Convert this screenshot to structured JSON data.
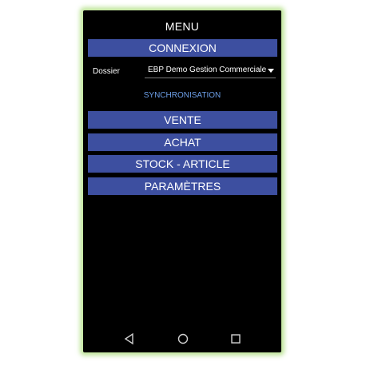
{
  "header": {
    "title": "MENU"
  },
  "menu": {
    "connexion_label": "CONNEXION",
    "vente_label": "VENTE",
    "achat_label": "ACHAT",
    "stock_label": "STOCK - ARTICLE",
    "parametres_label": "PARAMÈTRES"
  },
  "dossier": {
    "label": "Dossier",
    "selected": "EBP Demo Gestion Commerciale"
  },
  "sync": {
    "label": "SYNCHRONISATION"
  },
  "navbar": {
    "back_icon": "back-triangle-icon",
    "home_icon": "home-circle-icon",
    "recent_icon": "recent-apps-square-icon"
  },
  "colors": {
    "button_bg": "#3d4fa0",
    "screen_bg": "#000000",
    "link": "#6d9fe8",
    "glow": "#aadc78"
  }
}
